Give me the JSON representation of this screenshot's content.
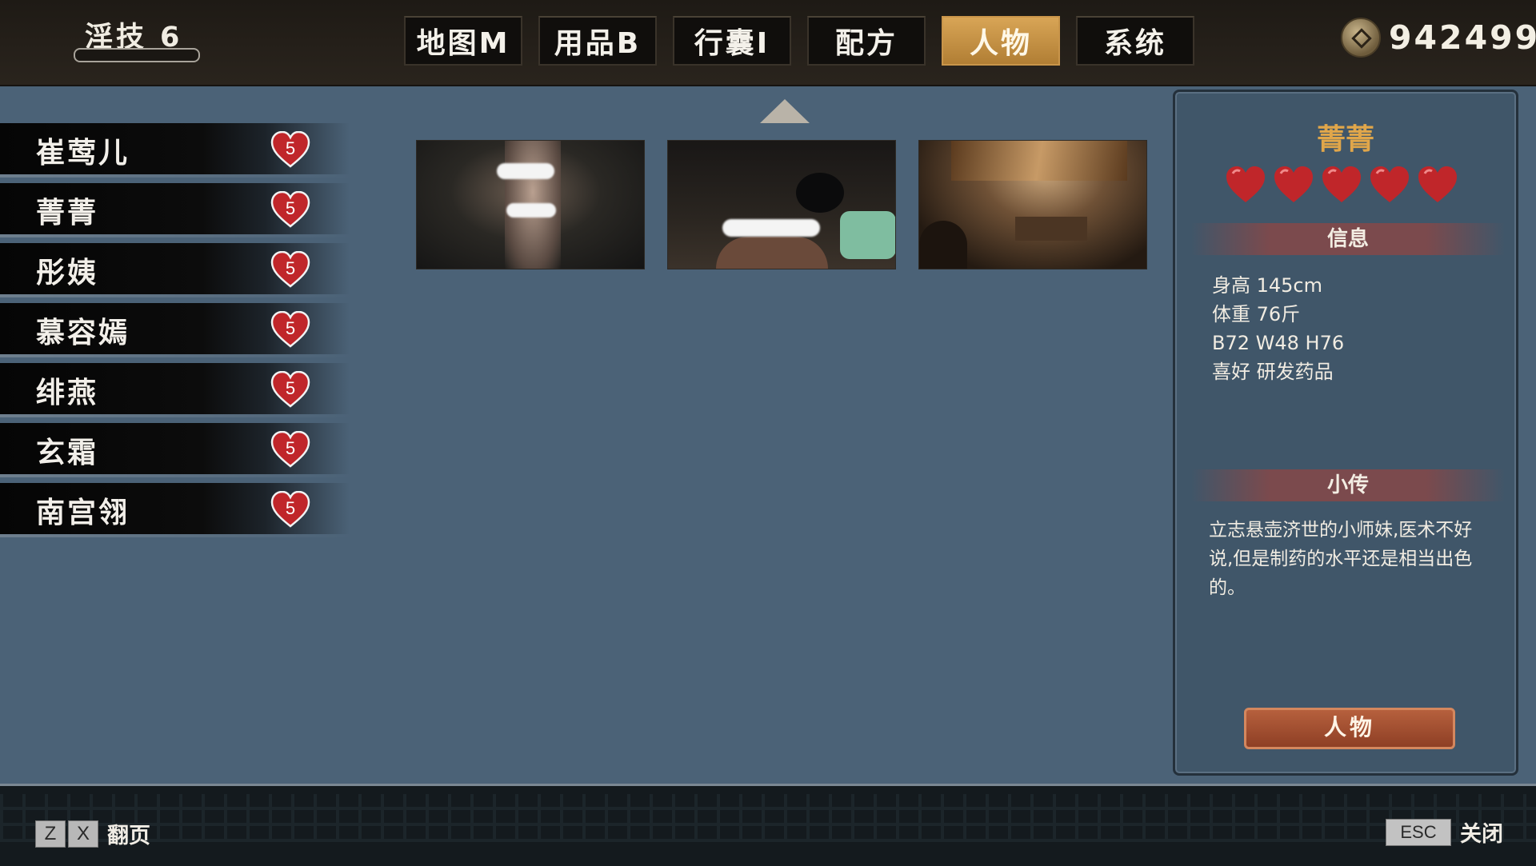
{
  "header": {
    "skill_label": "淫技",
    "skill_value": "6",
    "coins": "942499",
    "tabs": [
      {
        "label": "地图M",
        "active": false
      },
      {
        "label": "用品B",
        "active": false
      },
      {
        "label": "行囊I",
        "active": false
      },
      {
        "label": "配方",
        "active": false
      },
      {
        "label": "人物",
        "active": true
      },
      {
        "label": "系统",
        "active": false
      }
    ]
  },
  "characters": [
    {
      "name": "崔莺儿",
      "affection": "5"
    },
    {
      "name": "菁菁",
      "affection": "5"
    },
    {
      "name": "彤姨",
      "affection": "5"
    },
    {
      "name": "慕容嫣",
      "affection": "5"
    },
    {
      "name": "绯燕",
      "affection": "5"
    },
    {
      "name": "玄霜",
      "affection": "5"
    },
    {
      "name": "南宫翎",
      "affection": "5"
    }
  ],
  "gallery": {
    "thumbnails": 3
  },
  "detail": {
    "name": "菁菁",
    "hearts": 5,
    "info_title": "信息",
    "info": [
      "身高 145cm",
      "体重 76斤",
      "B72 W48 H76",
      "喜好 研发药品"
    ],
    "bio_title": "小传",
    "bio": "立志悬壶济世的小师妹,医术不好说,但是制药的水平还是相当出色的。",
    "button_label": "人物"
  },
  "footer": {
    "page_keys": [
      "Z",
      "X"
    ],
    "page_label": "翻页",
    "close_key": "ESC",
    "close_label": "关闭"
  },
  "colors": {
    "accent": "#d8a556",
    "heart": "#c0262a",
    "name_highlight": "#e0a64a",
    "panel_bg": "#405669",
    "page_bg": "#4b6277"
  }
}
